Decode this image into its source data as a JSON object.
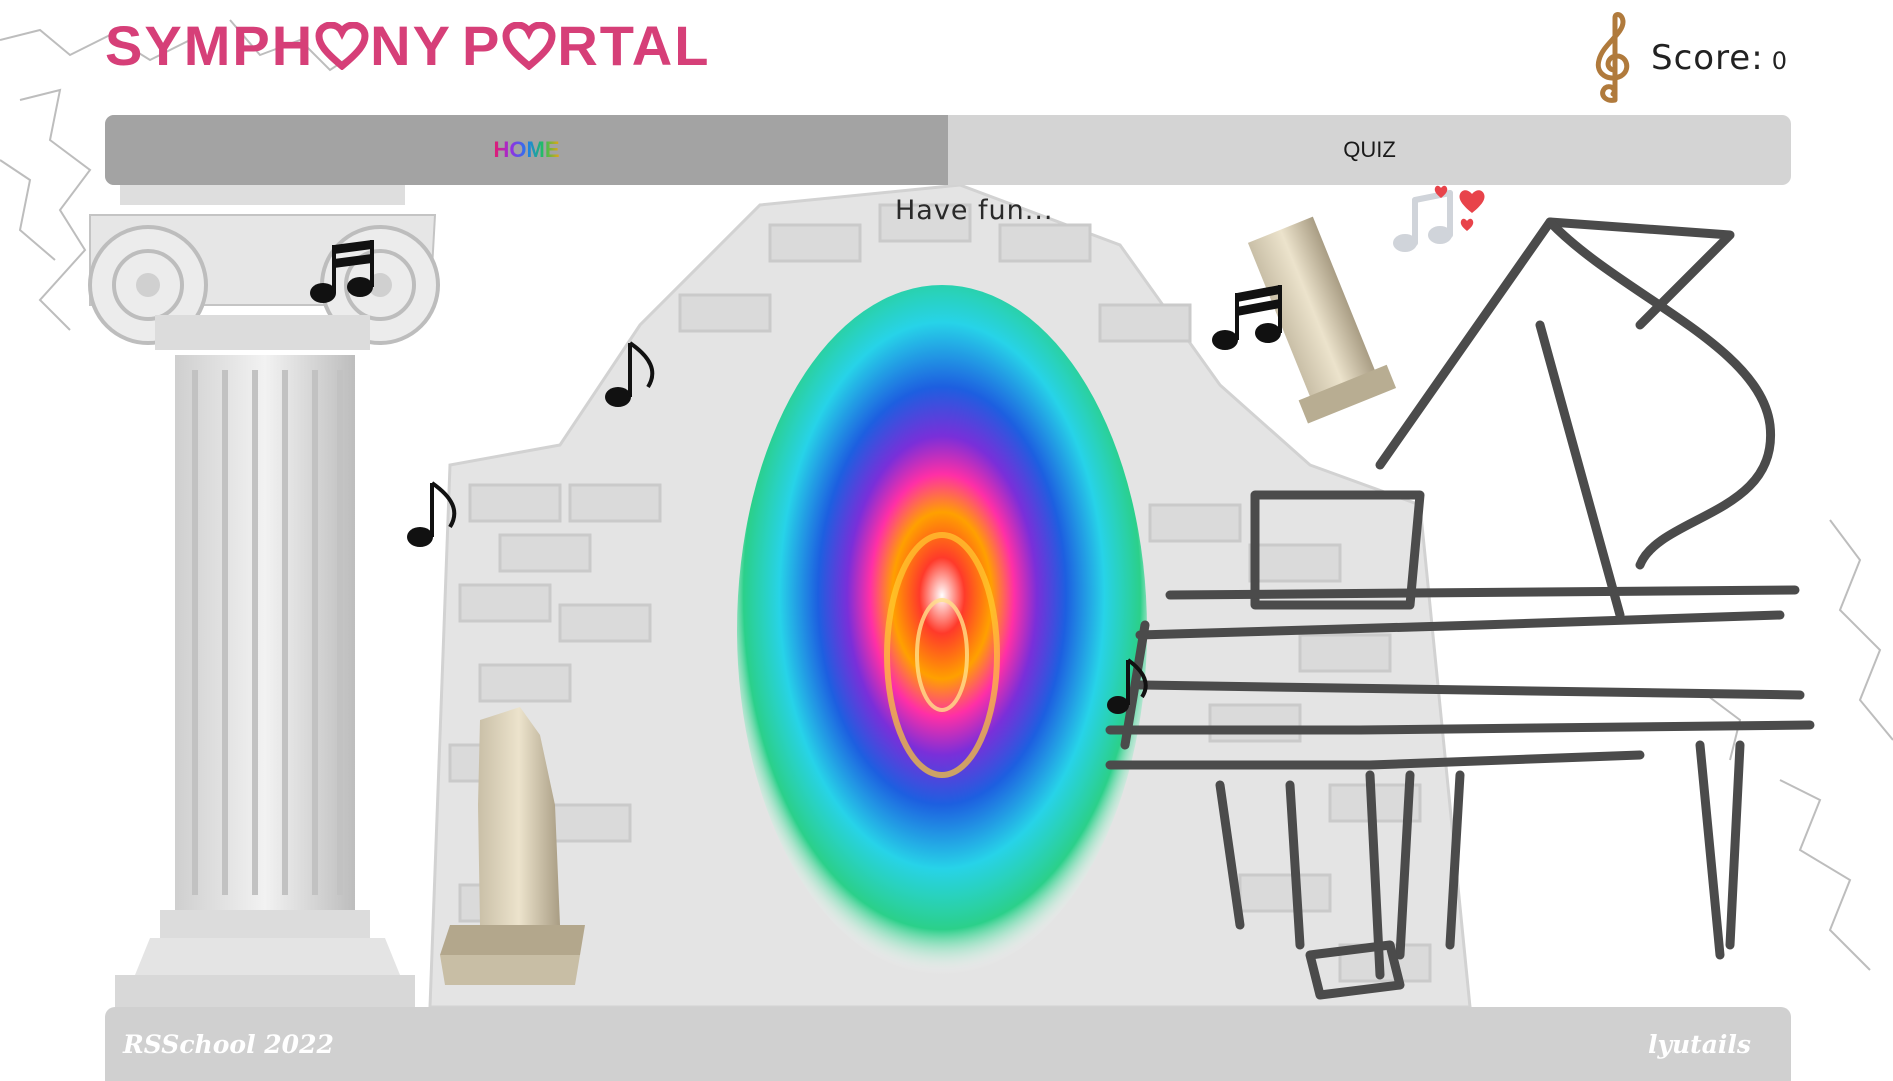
{
  "header": {
    "logo_part1": "SYMPH",
    "logo_part2": "NY",
    "logo_part3": "P",
    "logo_part4": "RTAL",
    "score_label": "Score:",
    "score_value": "0"
  },
  "nav": {
    "tabs": [
      {
        "label": "HOME",
        "active": true
      },
      {
        "label": "QUIZ",
        "active": false
      }
    ]
  },
  "main": {
    "caption": "Have fun..."
  },
  "footer": {
    "left": "RSSchool 2022",
    "right": "lyutails"
  },
  "colors": {
    "brand": "#d63f78",
    "nav_active": "#a3a3a3",
    "nav_bg": "#d4d4d4",
    "footer_bg": "#d0d0d0"
  },
  "icons": [
    "heart-icon",
    "treble-clef-icon",
    "music-note-icon",
    "beamed-notes-icon",
    "hearts-icon",
    "portal",
    "piano",
    "ionic-column",
    "broken-column"
  ]
}
